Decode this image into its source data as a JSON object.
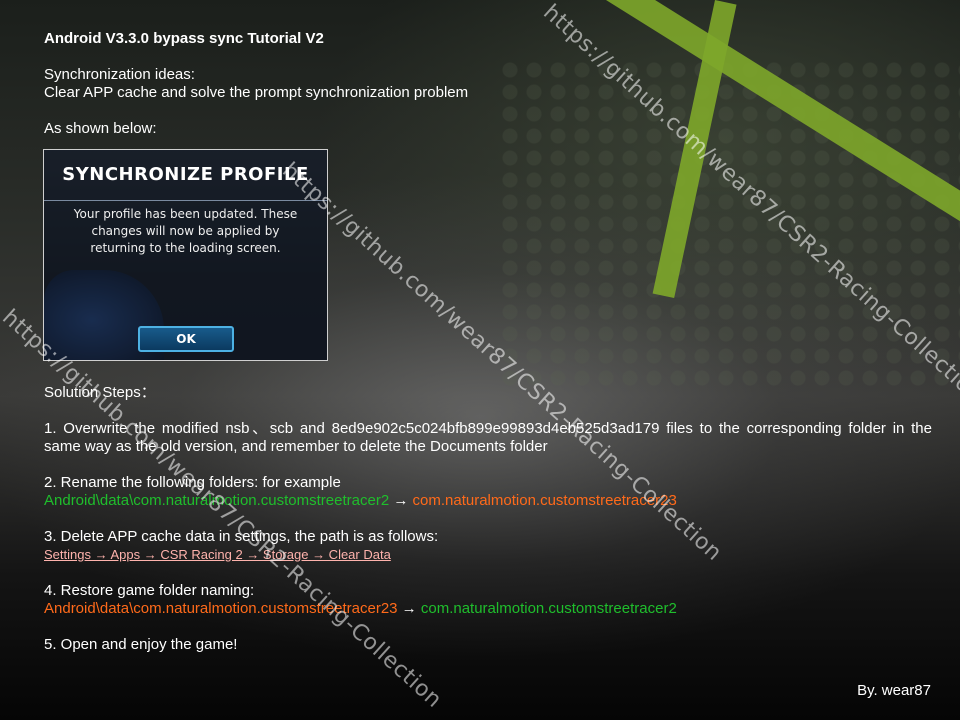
{
  "title": "Android V3.3.0 bypass sync Tutorial V2",
  "intro": {
    "heading": "Synchronization ideas:",
    "line": "Clear APP cache and solve the prompt synchronization problem",
    "shown": "As shown below:"
  },
  "dialog": {
    "title": "SYNCHRONIZE PROFILE",
    "body": "Your profile has been updated. These changes will now be applied by returning to the loading screen.",
    "ok_label": "OK"
  },
  "solution": {
    "heading": "Solution Steps：",
    "step1": "1. Overwrite the modified nsb、scb and 8ed9e902c5c024bfb899e99893d4eb525d3ad179 files to the corresponding folder in the same way as the old version, and remember to delete the Documents folder",
    "step2_title": "2. Rename the following folders: for example",
    "step2_from": "Android\\data\\com.naturalmotion.customstreetracer2",
    "step2_arrow": " → ",
    "step2_to": "com.naturalmotion.customstreetracer23",
    "step3_title": "3. Delete APP cache data in settings, the path is as follows:",
    "step3_path": "Settings → Apps → CSR Racing 2 → Storage → Clear Data",
    "step4_title": "4. Restore game folder naming:",
    "step4_from": "Android\\data\\com.naturalmotion.customstreetracer23",
    "step4_arrow": " → ",
    "step4_to": "com.naturalmotion.customstreetracer2",
    "step5": "5. Open and enjoy the game!"
  },
  "byline": "By. wear87",
  "watermarks": [
    "https://github.com/wear87/CSR2-Racing-Collection",
    "https://github.com/wear87/CSR2-Racing-Collection",
    "https://github.com/wear87/CSR2-Racing-Collection"
  ],
  "colors": {
    "accent_green": "#1fbe2c",
    "accent_orange": "#ff6a1a",
    "link_pink": "#ffb3ad",
    "stripe_lime": "#7ea72a"
  }
}
